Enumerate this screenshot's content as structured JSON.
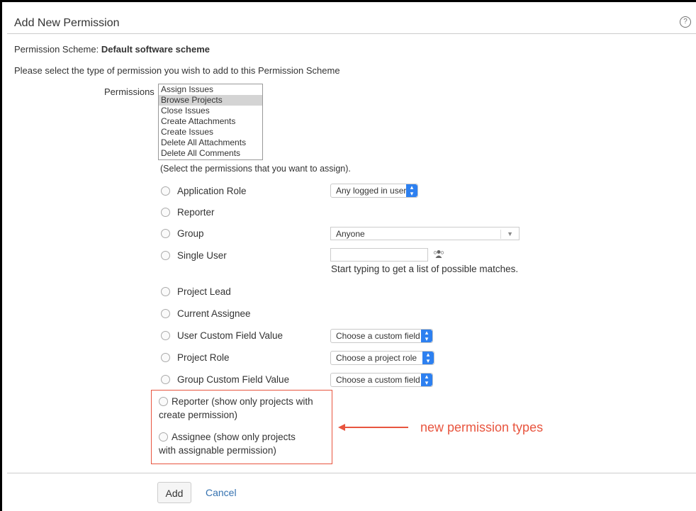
{
  "dialog": {
    "title": "Add New Permission",
    "help_icon": "?",
    "scheme_label": "Permission Scheme:",
    "scheme_name": "Default software scheme",
    "instructions": "Please select the type of permission you wish to add to this Permission Scheme"
  },
  "permissions": {
    "label": "Permissions",
    "options": [
      "Assign Issues",
      "Browse Projects",
      "Close Issues",
      "Create Attachments",
      "Create Issues",
      "Delete All Attachments",
      "Delete All Comments"
    ],
    "selected": "Browse Projects",
    "hint": "(Select the permissions that you want to assign)."
  },
  "grant_types": [
    {
      "label": "Application Role",
      "select": "Any logged in user"
    },
    {
      "label": "Reporter"
    },
    {
      "label": "Group",
      "select": "Anyone"
    },
    {
      "label": "Single User",
      "hint": "Start typing to get a list of possible matches."
    },
    {
      "label": "Project Lead"
    },
    {
      "label": "Current Assignee"
    },
    {
      "label": "User Custom Field Value",
      "select": "Choose a custom field"
    },
    {
      "label": "Project Role",
      "select": "Choose a project role"
    },
    {
      "label": "Group Custom Field Value",
      "select": "Choose a custom field"
    }
  ],
  "new_types": [
    {
      "line1": "Reporter (show only projects with",
      "line2": "create permission)"
    },
    {
      "line1": "Assignee (show only projects",
      "line2": "with assignable permission)"
    }
  ],
  "annotation": "new permission types",
  "buttons": {
    "add": "Add",
    "cancel": "Cancel"
  },
  "icons": {
    "help": "help-icon",
    "user_picker": "user-picker-icon",
    "select_arrows": "select-arrows-icon"
  },
  "colors": {
    "accent": "#2d80f0",
    "annotation": "#e8553f",
    "link": "#3572b0"
  }
}
